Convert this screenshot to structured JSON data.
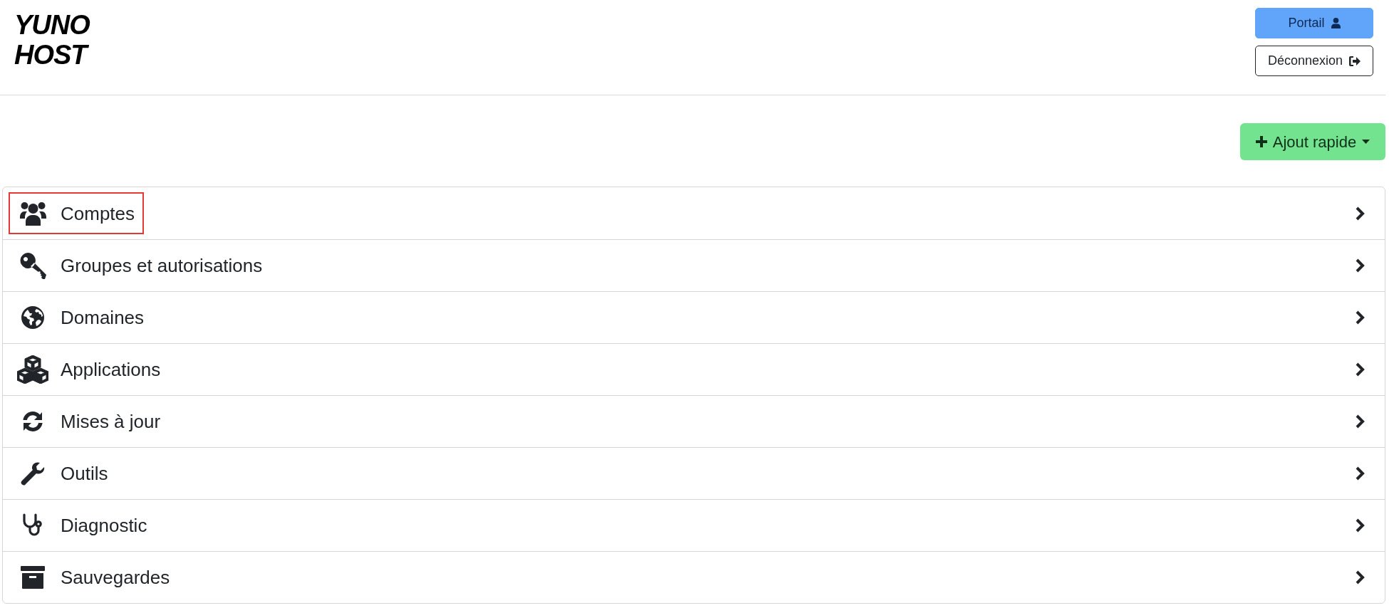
{
  "header": {
    "logo": {
      "lines": [
        "YUNO",
        "HOST"
      ]
    },
    "buttons": [
      {
        "label": "Portail",
        "kind": "primary"
      },
      {
        "label": "Déconnexion",
        "kind": "outline"
      }
    ]
  },
  "quick_add": {
    "label": "Ajout rapide"
  },
  "menu": {
    "items": [
      {
        "label": "Comptes",
        "highlighted": true
      },
      {
        "label": "Groupes et autorisations",
        "highlighted": false
      },
      {
        "label": "Domaines",
        "highlighted": false
      },
      {
        "label": "Applications",
        "highlighted": false
      },
      {
        "label": "Mises à jour",
        "highlighted": false
      },
      {
        "label": "Outils",
        "highlighted": false
      },
      {
        "label": "Diagnostic",
        "highlighted": false
      },
      {
        "label": "Sauvegardes",
        "highlighted": false
      }
    ]
  }
}
